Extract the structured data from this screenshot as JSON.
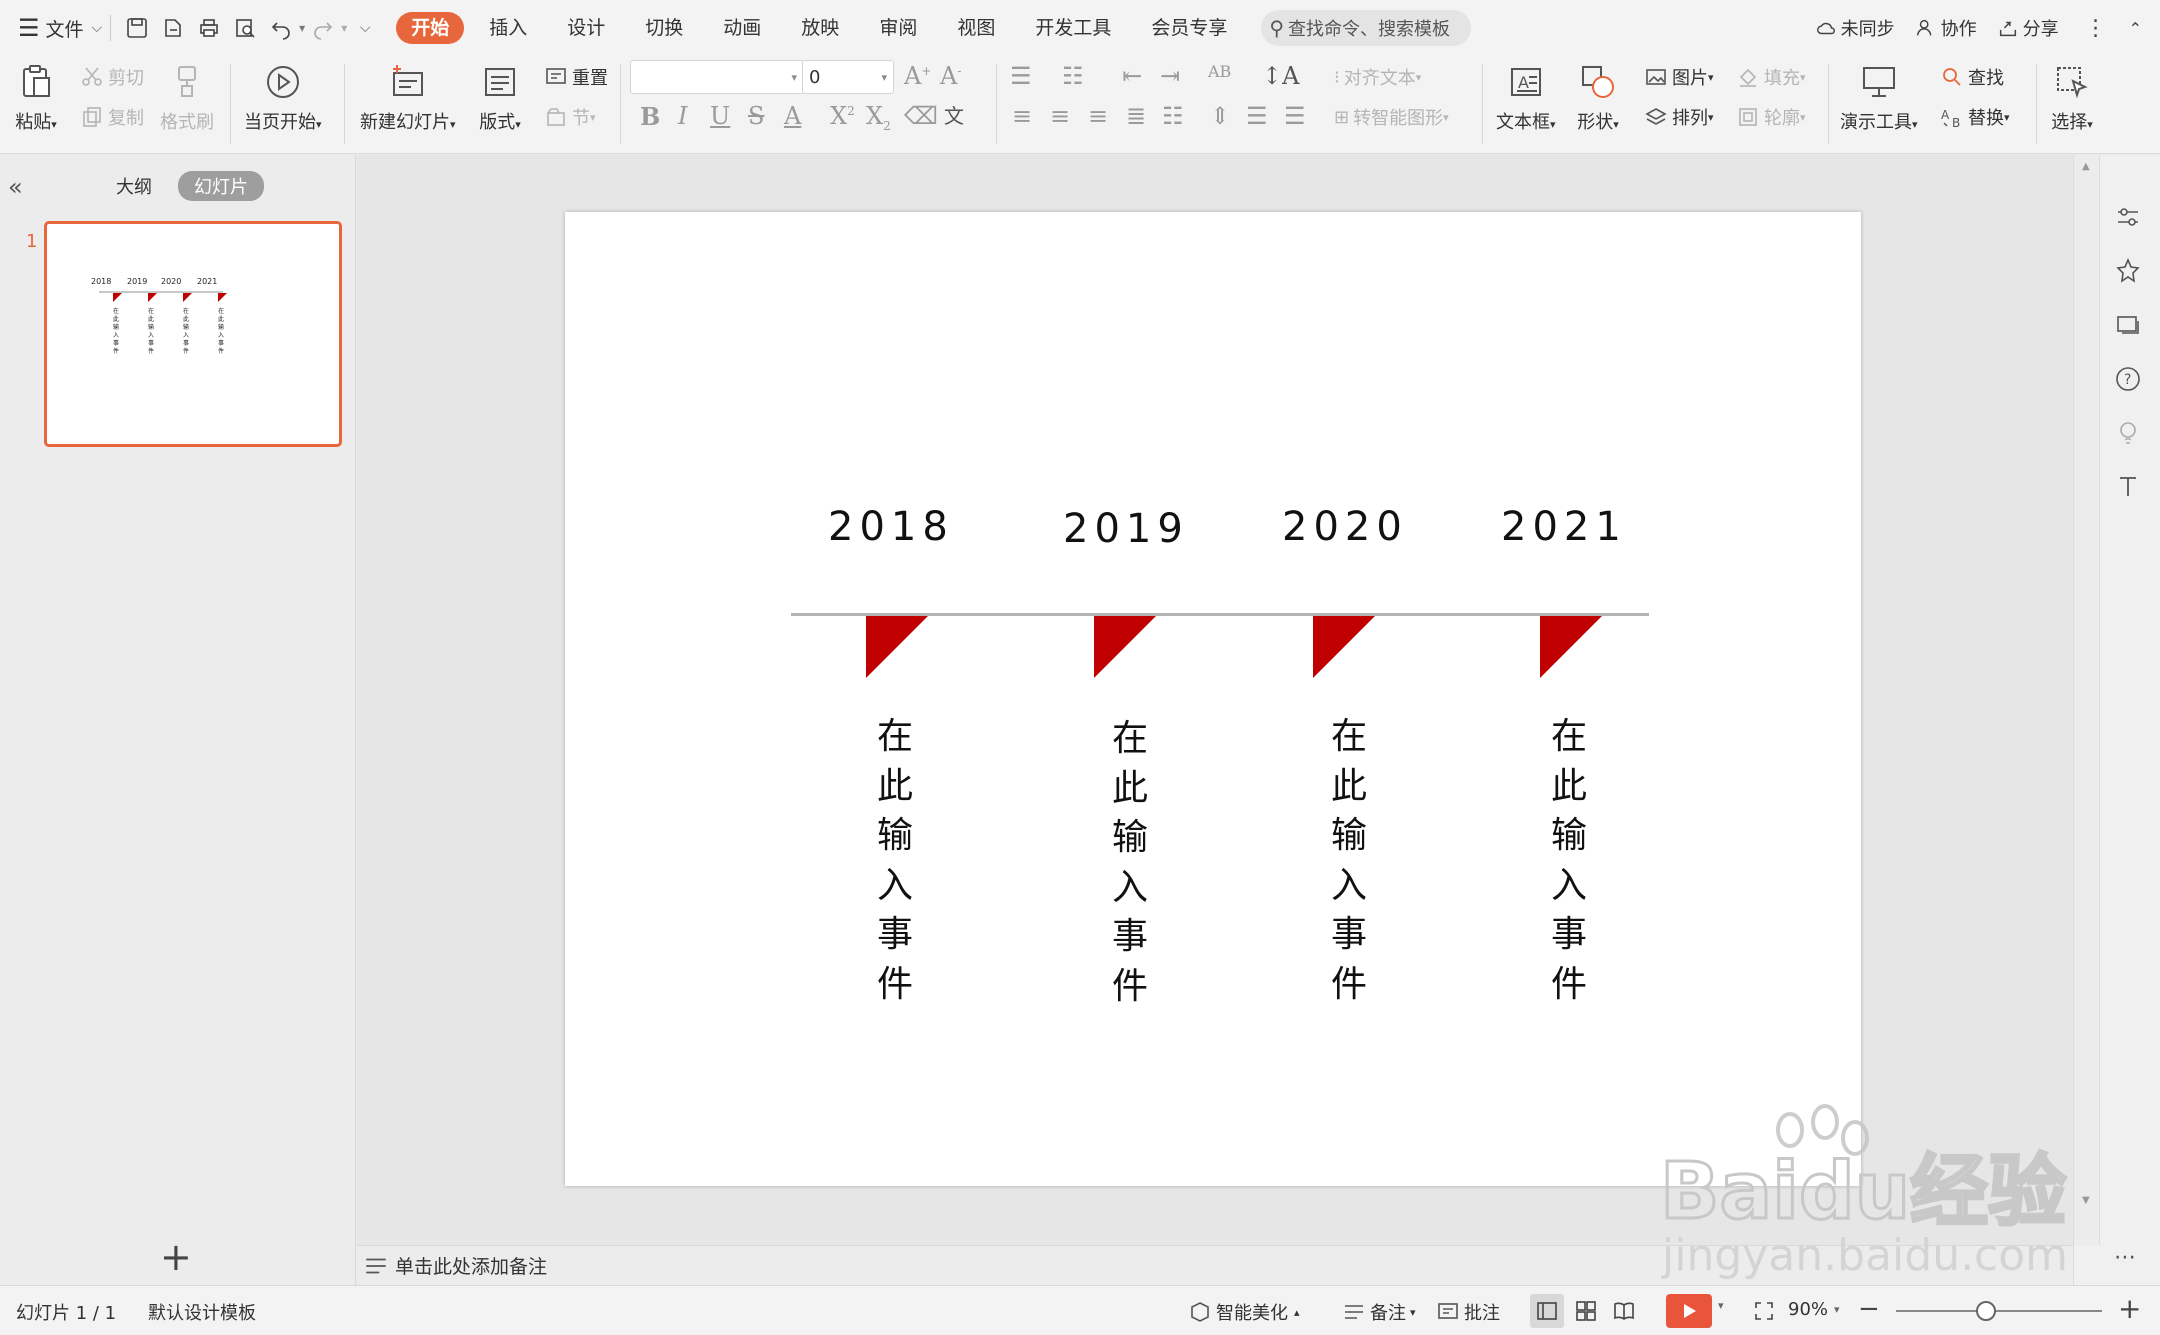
{
  "menubar": {
    "file_label": "文件",
    "tabs": [
      "开始",
      "插入",
      "设计",
      "切换",
      "动画",
      "放映",
      "审阅",
      "视图",
      "开发工具",
      "会员专享"
    ],
    "active_tab": "开始",
    "search_placeholder": "查找命令、搜索模板",
    "sync_label": "未同步",
    "collab_label": "协作",
    "share_label": "分享"
  },
  "ribbon": {
    "paste": "粘贴",
    "cut": "剪切",
    "copy": "复制",
    "format_painter": "格式刷",
    "from_current": "当页开始",
    "new_slide": "新建幻灯片",
    "layout": "版式",
    "reset": "重置",
    "section": "节",
    "font_name": "",
    "font_size": "0",
    "convert_text": "对齐文本",
    "smart_shape": "转智能图形",
    "textbox": "文本框",
    "shape": "形状",
    "picture": "图片",
    "fill": "填充",
    "arrange": "排列",
    "outline": "轮廓",
    "present_tools": "演示工具",
    "find": "查找",
    "replace": "替换",
    "select": "选择"
  },
  "leftpanel": {
    "tab_outline": "大纲",
    "tab_slides": "幻灯片",
    "slide_number": "1"
  },
  "slide": {
    "years": [
      "2018",
      "2019",
      "2020",
      "2021"
    ],
    "events": [
      "在此输入事件",
      "在此输入事件",
      "在此输入事件",
      "在此输入事件"
    ],
    "flag_color": "#c00000",
    "line_color": "#b5b5b5"
  },
  "notes": {
    "placeholder": "单击此处添加备注"
  },
  "statusbar": {
    "slide_info": "幻灯片 1 / 1",
    "template": "默认设计模板",
    "beautify": "智能美化",
    "notes": "备注",
    "comments": "批注",
    "zoom": "90%"
  },
  "watermark": {
    "brand": "Baidu经验",
    "url": "jingyan.baidu.com"
  },
  "colors": {
    "accent": "#e8663b",
    "play": "#e8553b"
  }
}
